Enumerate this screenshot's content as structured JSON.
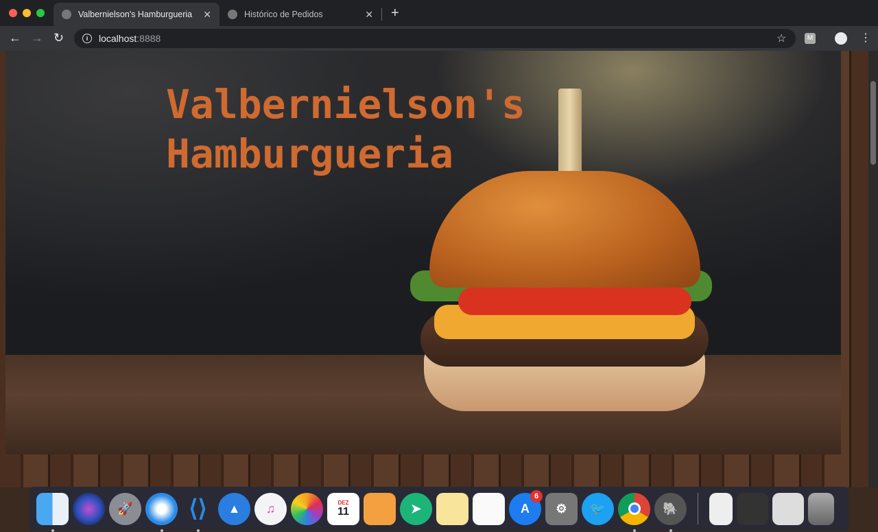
{
  "browser": {
    "tabs": [
      {
        "title": "Valbernielson's Hamburgueria",
        "active": true
      },
      {
        "title": "Histórico de Pedidos",
        "active": false
      }
    ],
    "close_glyph": "✕",
    "new_tab_glyph": "+",
    "url_host": "localhost",
    "url_port": ":8888",
    "ext_label": "M"
  },
  "hero": {
    "title": "Valbernielson's Hamburgueria"
  },
  "dock": {
    "apps": [
      "finder",
      "siri",
      "launchpad",
      "safari",
      "vscode",
      "spark",
      "music",
      "photos",
      "calendar",
      "pages",
      "direct-mail",
      "notes",
      "reminders",
      "app-store",
      "system-preferences",
      "twitter",
      "chrome",
      "mamp"
    ],
    "calendar_month": "DEZ",
    "calendar_day": "11",
    "app_store_badge": "6"
  }
}
